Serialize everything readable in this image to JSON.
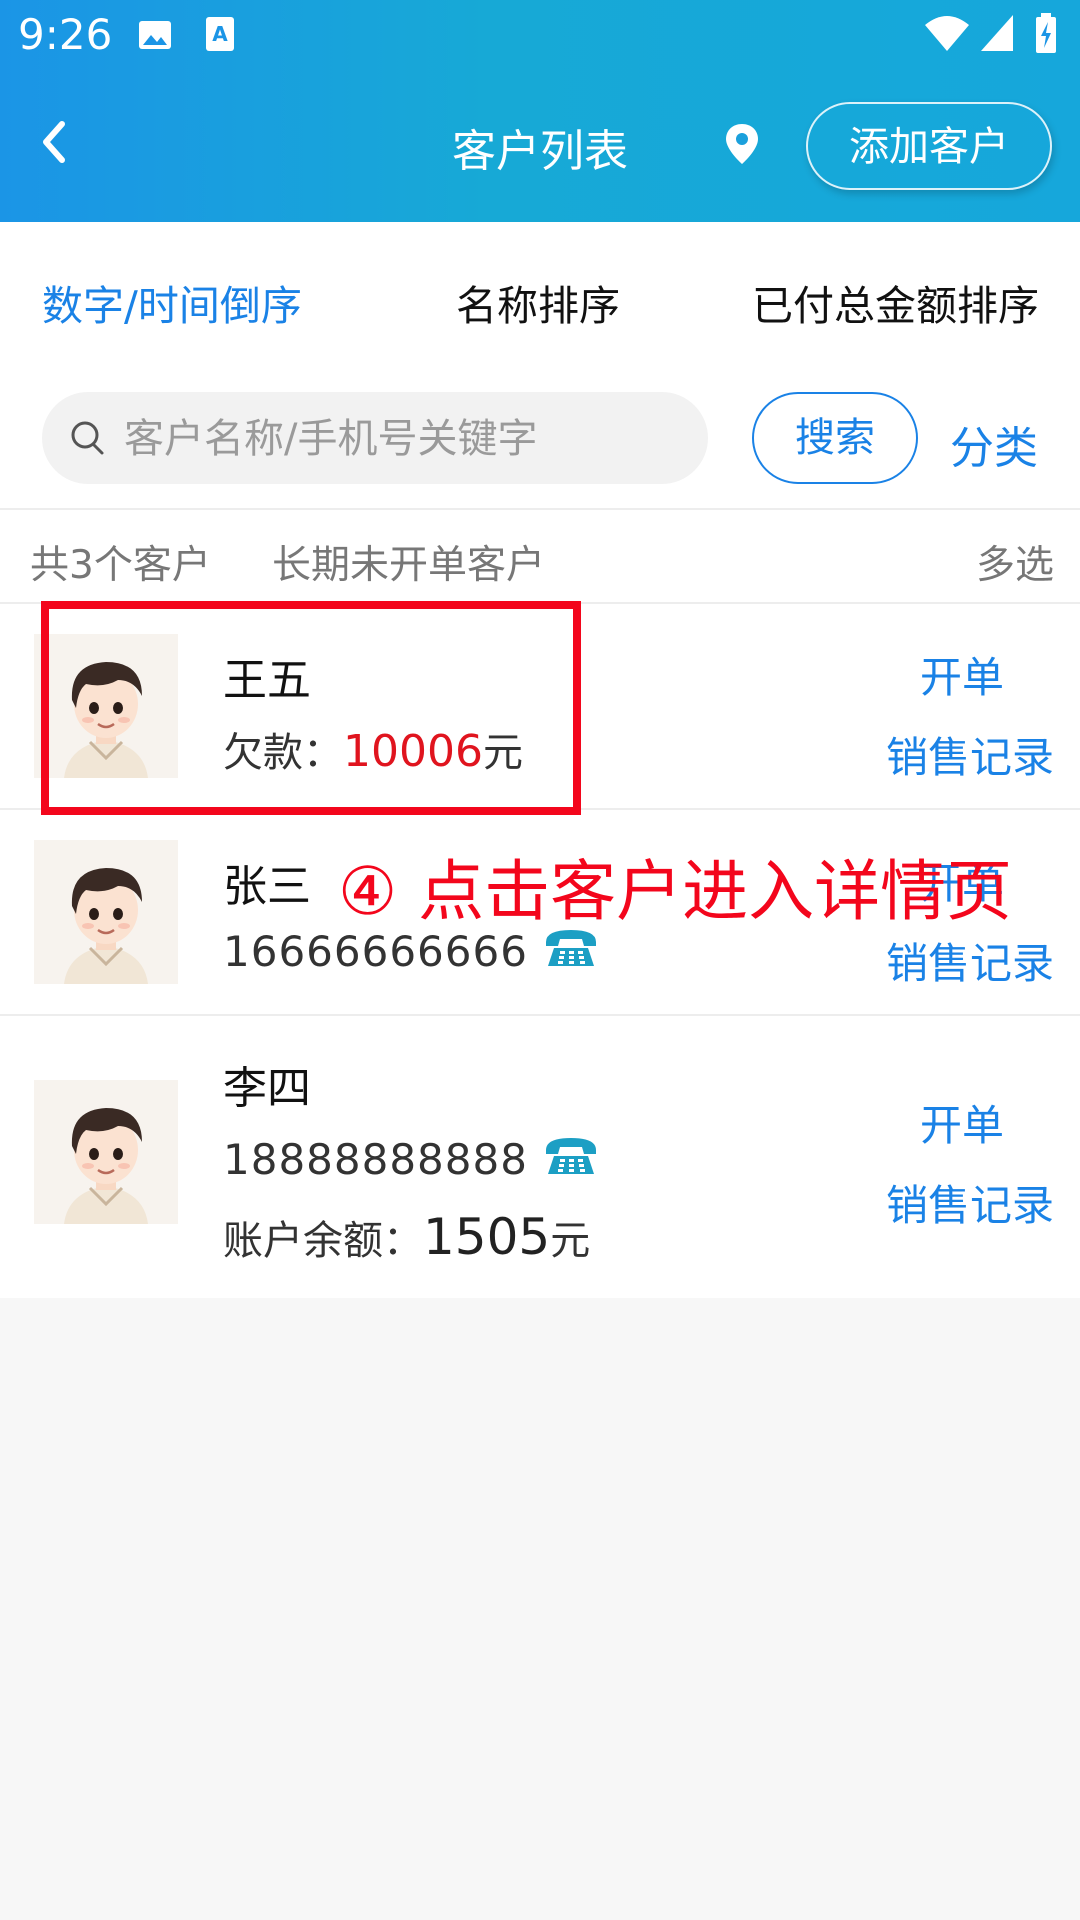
{
  "status_bar": {
    "time": "9:26",
    "icons": [
      "image-icon",
      "a-badge-icon",
      "wifi-icon",
      "signal-icon",
      "battery-icon"
    ]
  },
  "header": {
    "title": "客户列表",
    "back_icon": "chevron-left-icon",
    "location_icon": "location-pin-icon",
    "add_button": "添加客户"
  },
  "sort_tabs": [
    {
      "label": "数字/时间倒序",
      "active": true
    },
    {
      "label": "名称排序",
      "active": false
    },
    {
      "label": "已付总金额排序",
      "active": false
    }
  ],
  "search": {
    "placeholder": "客户名称/手机号关键字",
    "value": "",
    "button": "搜索",
    "category": "分类"
  },
  "summary": {
    "count_text": "共3个客户",
    "inactive_text": "长期未开单客户",
    "multi_select": "多选"
  },
  "customers": [
    {
      "name": "王五",
      "debt_label": "欠款：",
      "debt_value": "10006",
      "debt_unit": "元",
      "action_open": "开单",
      "action_records": "销售记录"
    },
    {
      "name": "张三",
      "phone": "16666666666",
      "action_open": "开单",
      "action_records": "销售记录"
    },
    {
      "name": "李四",
      "phone": "18888888888",
      "balance_label": "账户余额：",
      "balance_value": "1505",
      "balance_unit": "元",
      "action_open": "开单",
      "action_records": "销售记录"
    }
  ],
  "annotation": "④ 点击客户进入详情页",
  "colors": {
    "accent": "#1a82e6",
    "header_gradient_start": "#1b95e6",
    "header_gradient_end": "#16a7db",
    "debt_red": "#e0141e",
    "annotation_red": "#f3061c",
    "phone_teal": "#1c9fc4"
  }
}
